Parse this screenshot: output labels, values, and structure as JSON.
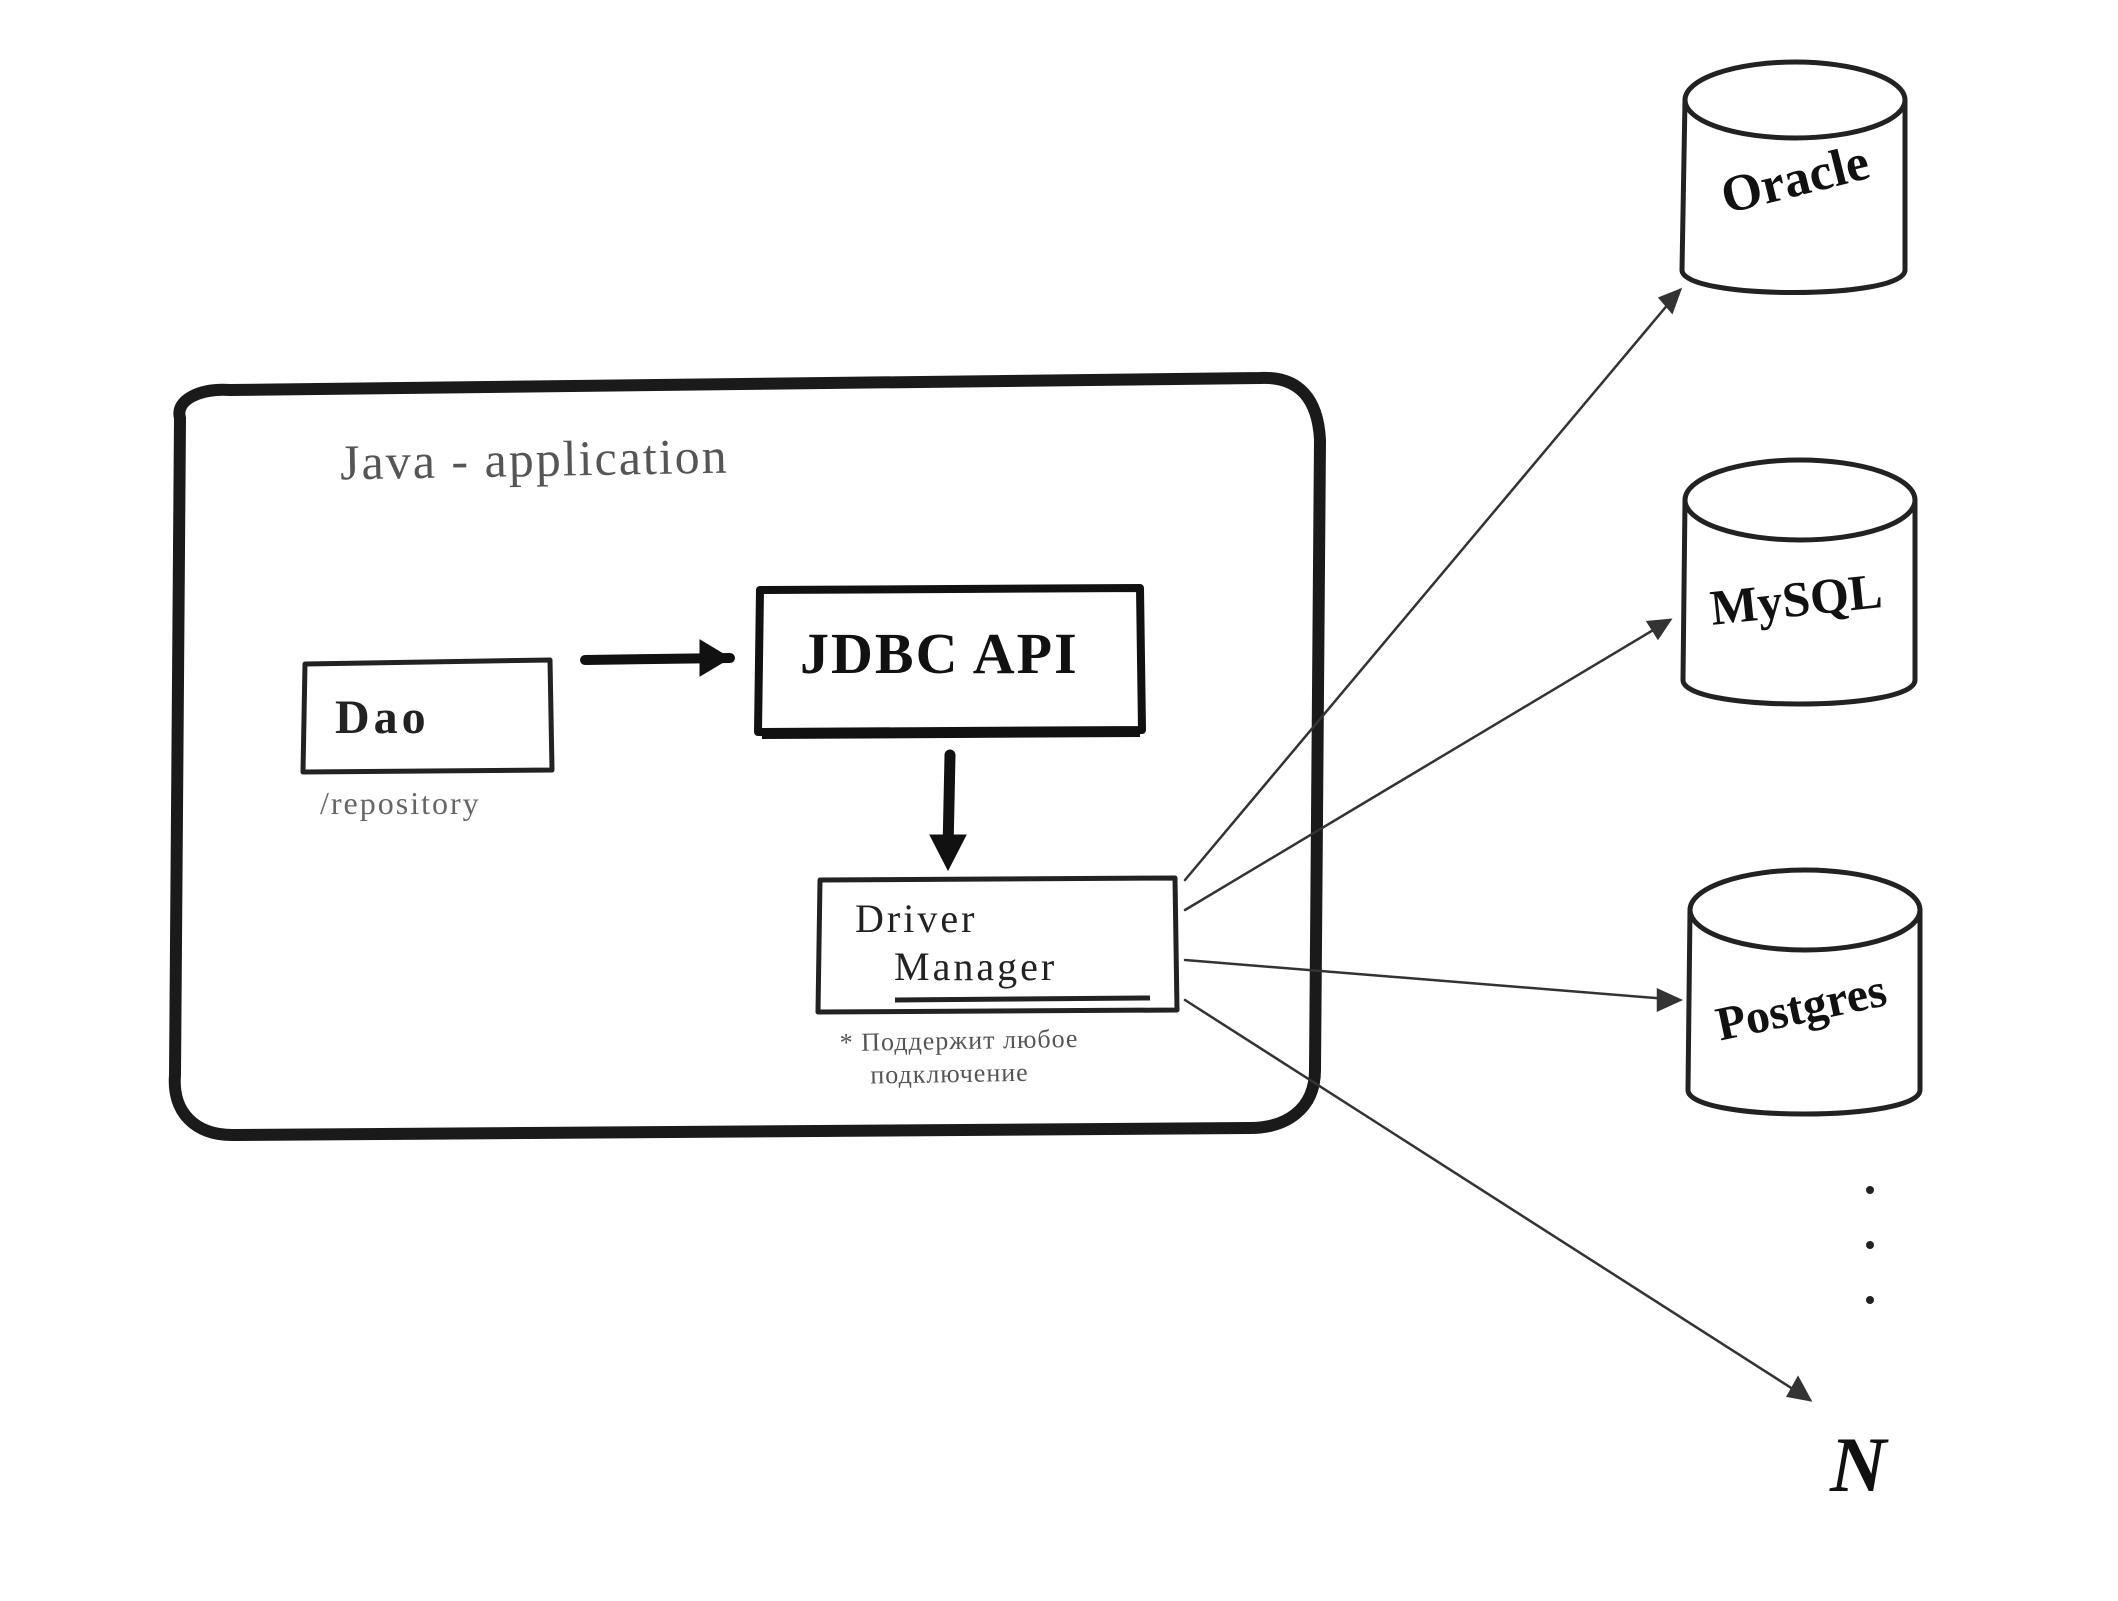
{
  "app": {
    "title": "Java - application",
    "dao_label": "Dao",
    "repository_label": "/repository",
    "jdbc_label": "JDBC API",
    "driver_manager_line1": "Driver",
    "driver_manager_line2": "Manager",
    "note_line1": "* Поддержит любое",
    "note_line2": "подключение"
  },
  "databases": {
    "oracle": "Oracle",
    "mysql": "MySQL",
    "postgres": "Postgres",
    "n_label": "N"
  }
}
